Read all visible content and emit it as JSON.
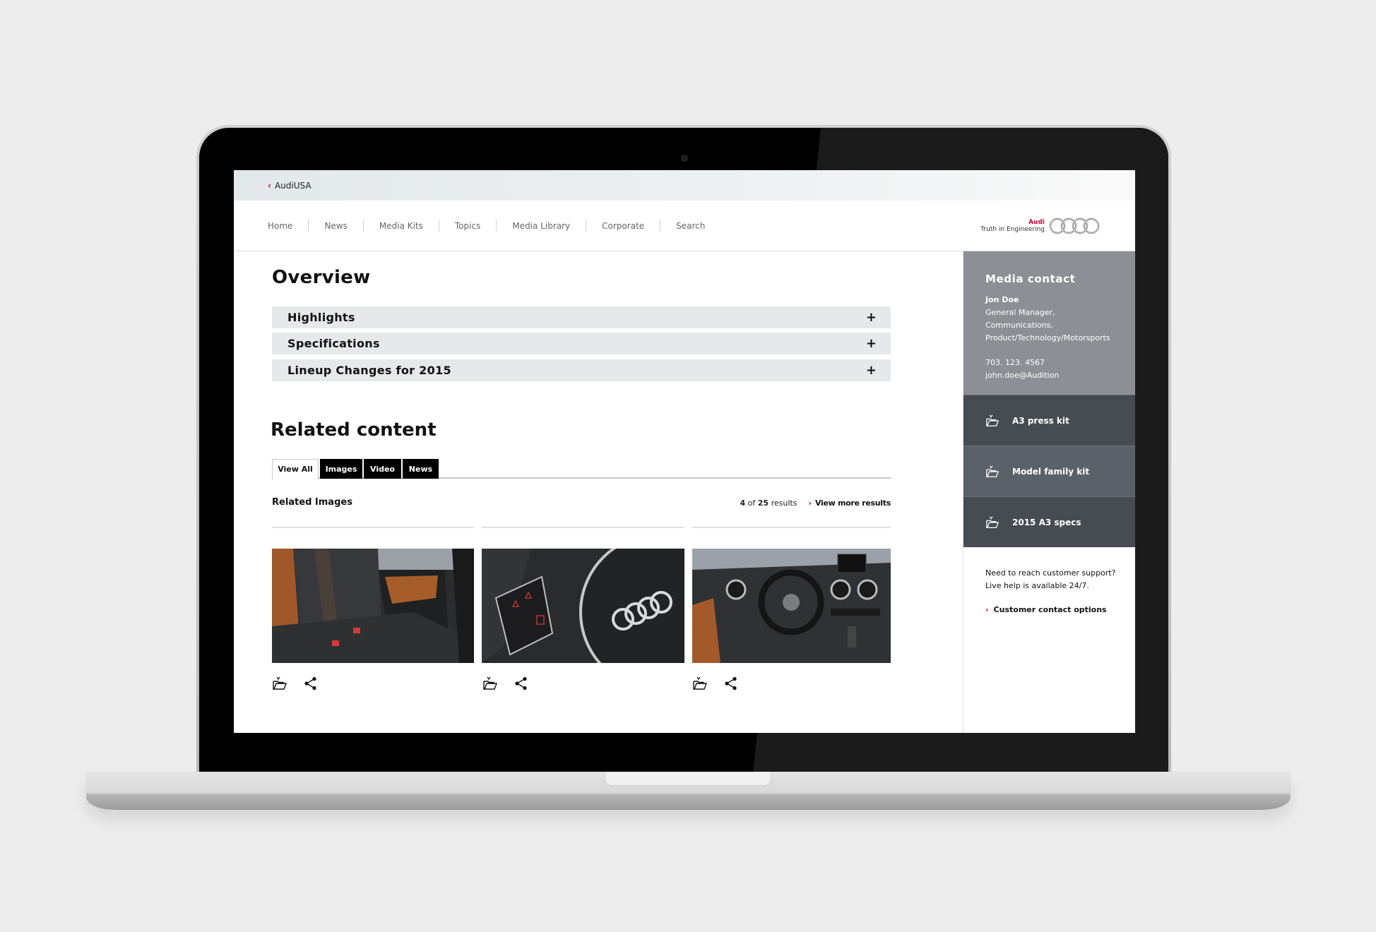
{
  "topbar": {
    "back_label": "AudiUSA"
  },
  "nav": {
    "items": [
      "Home",
      "News",
      "Media Kits",
      "Topics",
      "Media Library",
      "Corporate",
      "Search"
    ]
  },
  "brand": {
    "name": "Audi",
    "tagline": "Truth in Engineering",
    "accent": "#cc0033"
  },
  "overview": {
    "title": "Overview",
    "sections": [
      {
        "label": "Highlights",
        "toggle": "+"
      },
      {
        "label": "Specifications",
        "toggle": "+"
      },
      {
        "label": "Lineup Changes for 2015",
        "toggle": "+"
      }
    ]
  },
  "related": {
    "title": "Related content",
    "tabs": [
      {
        "label": "View All",
        "active": true
      },
      {
        "label": "Images",
        "active": false
      },
      {
        "label": "Video",
        "active": false
      },
      {
        "label": "News",
        "active": false
      }
    ],
    "images_title": "Related Images",
    "results_shown": "4",
    "results_of": "of",
    "results_total": "25",
    "results_word": "results",
    "view_more": "View more results",
    "thumbnails": [
      {
        "subject": "Rear leather seats with brown accents",
        "icons": [
          "folder-download-icon",
          "share-icon"
        ]
      },
      {
        "subject": "Steering wheel with Audi rings logo",
        "icons": [
          "folder-download-icon",
          "share-icon"
        ]
      },
      {
        "subject": "Dashboard and steering wheel interior",
        "icons": [
          "folder-download-icon",
          "share-icon"
        ]
      }
    ]
  },
  "sidebar": {
    "contact": {
      "title": "Media contact",
      "name": "Jon Doe",
      "role_line1": "General Manager, Communications,",
      "role_line2": "Product/Technology/Motorsports",
      "phone": "703. 123. 4567",
      "email": "john.doe@Audition"
    },
    "kits": [
      {
        "label": "A3 press kit",
        "icon": "folder-download-icon"
      },
      {
        "label": "Model family kit",
        "icon": "folder-download-icon",
        "hover": true
      },
      {
        "label": "2015 A3 specs",
        "icon": "folder-download-icon"
      }
    ],
    "support": {
      "question": "Need to reach customer support?",
      "availability": "Live help is available 24/7.",
      "link": "Customer contact options"
    }
  }
}
